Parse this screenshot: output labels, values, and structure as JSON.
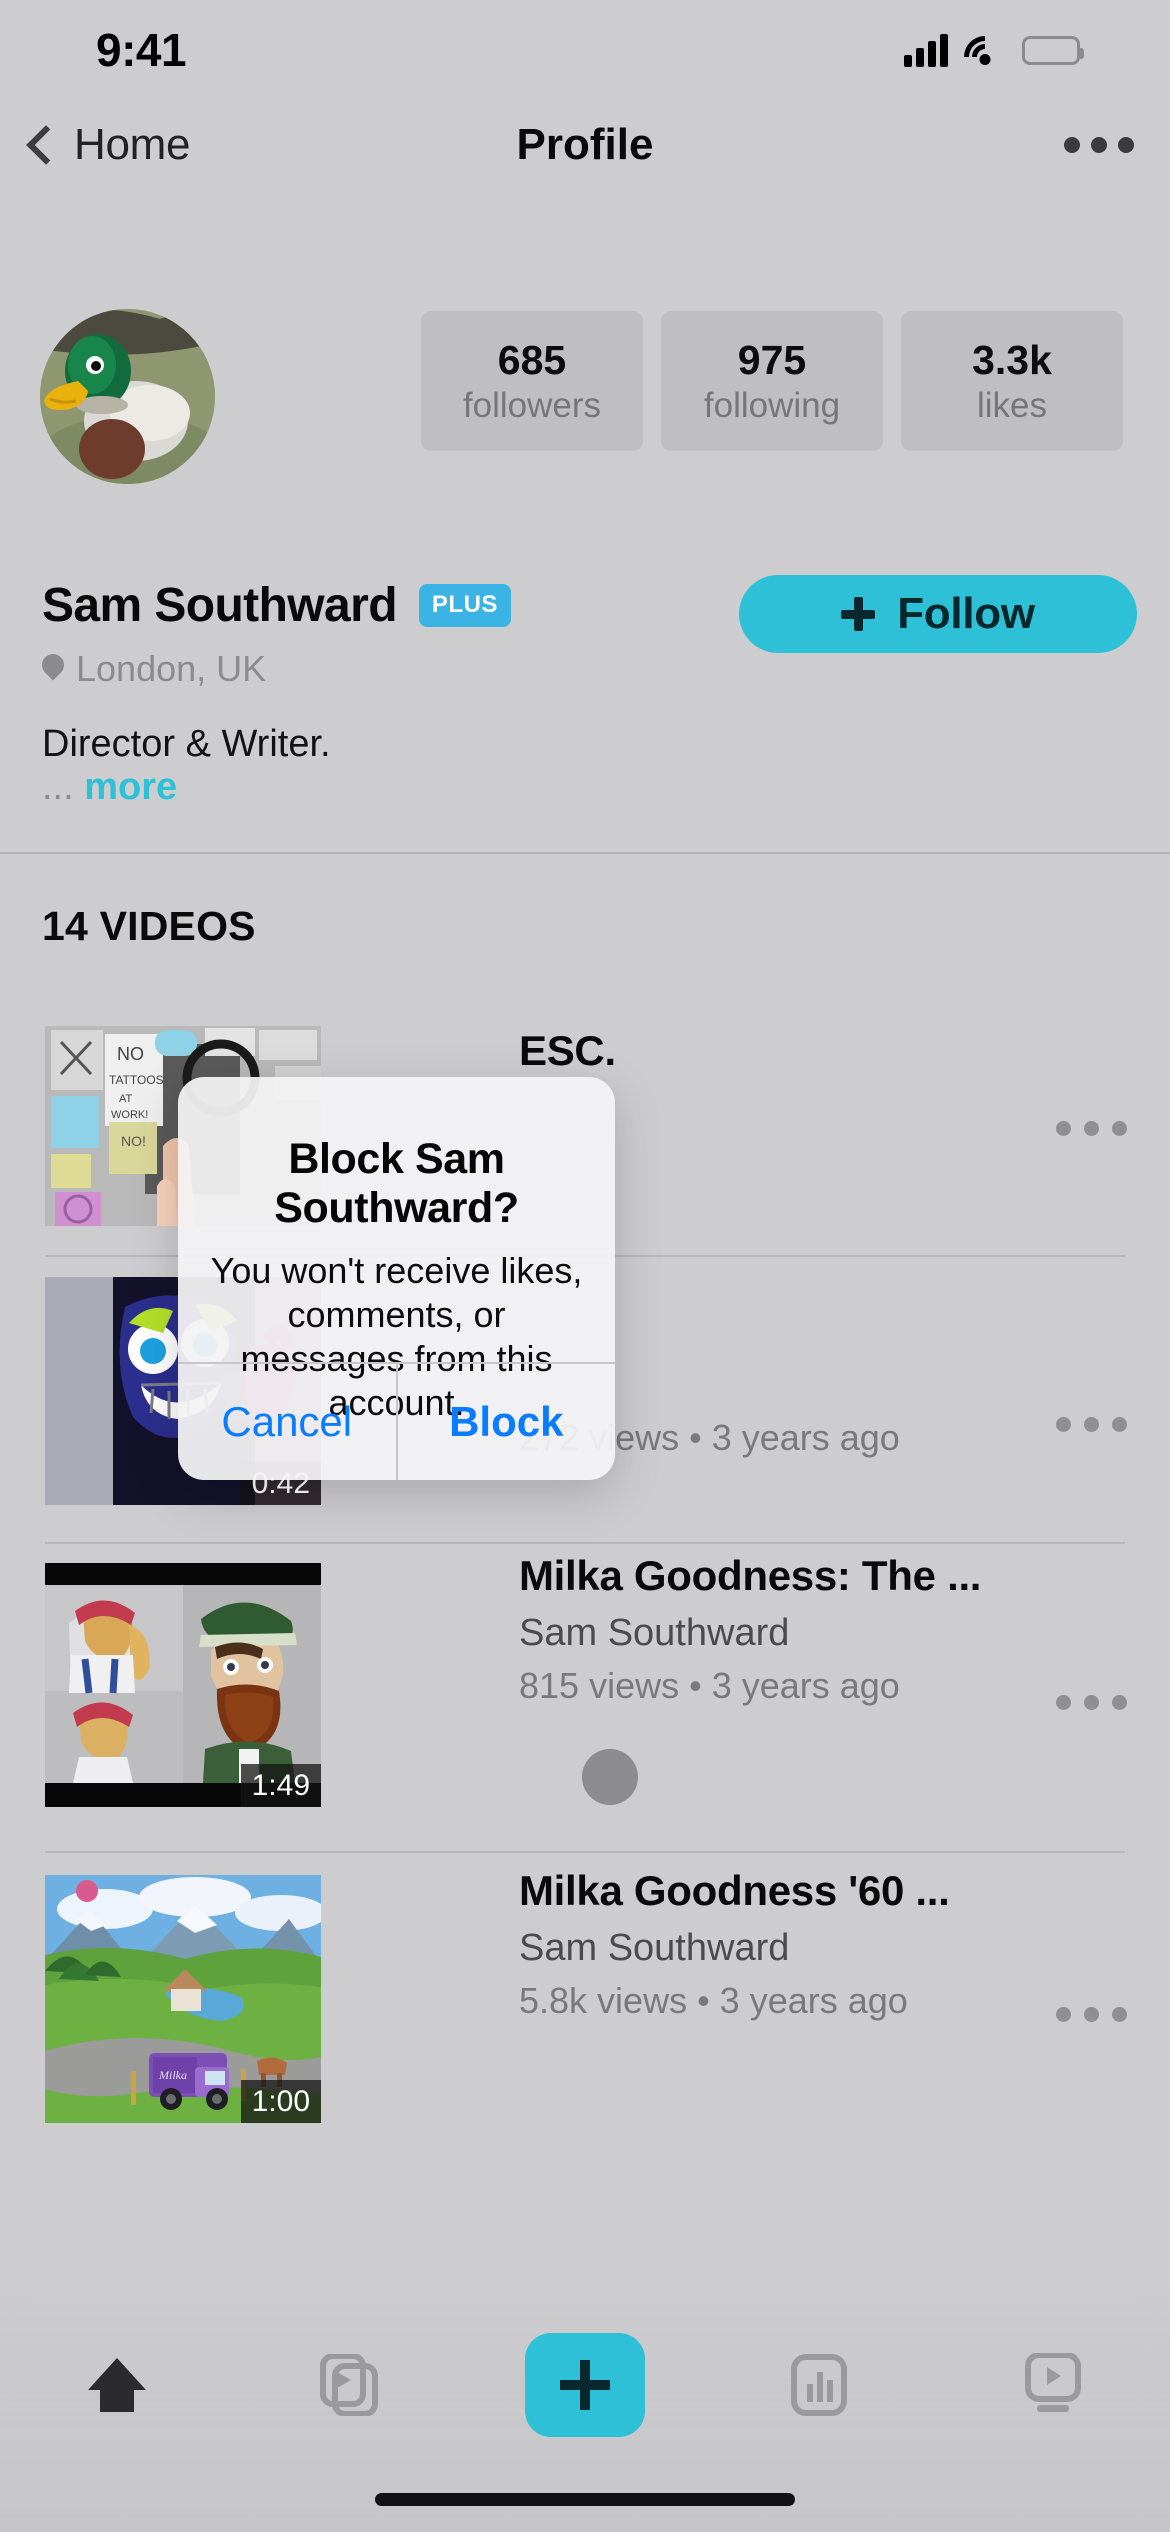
{
  "status_bar": {
    "time": "9:41",
    "cellular_icon": "signal-bars-icon",
    "wifi_icon": "wifi-icon",
    "battery_icon": "battery-icon"
  },
  "nav": {
    "back_label": "Home",
    "back_icon": "chevron-left-icon",
    "title": "Profile",
    "more_icon": "ellipsis-icon"
  },
  "profile": {
    "avatar_alt": "duck-avatar",
    "name": "Sam Southward",
    "badge": "PLUS",
    "location": "London, UK",
    "location_icon": "map-pin-icon",
    "bio": "Director & Writer.",
    "bio_truncation": "...",
    "bio_more_label": "more",
    "follow_label": "Follow",
    "follow_icon": "plus-icon",
    "stats": [
      {
        "value": "685",
        "label": "followers"
      },
      {
        "value": "975",
        "label": "following"
      },
      {
        "value": "3.3k",
        "label": "likes"
      }
    ]
  },
  "videos_section": {
    "header": "14 VIDEOS",
    "items": [
      {
        "title": "ESC.",
        "author": "",
        "meta": "",
        "duration": "",
        "thumb": "sticky-notes-no-tattoos-thumbnail",
        "more_icon": "ellipsis-icon"
      },
      {
        "title": "",
        "author": "",
        "meta": "272 views • 3 years ago",
        "duration": "0:42",
        "thumb": "cartoon-monster-thumbnail",
        "more_icon": "ellipsis-icon"
      },
      {
        "title": "Milka Goodness: The ...",
        "author": "Sam Southward",
        "meta": "815 views • 3 years ago",
        "duration": "1:49",
        "thumb": "claymation-characters-thumbnail",
        "more_icon": "ellipsis-icon"
      },
      {
        "title": "Milka Goodness '60 ...",
        "author": "Sam Southward",
        "meta": "5.8k views • 3 years ago",
        "duration": "1:00",
        "thumb": "purple-truck-alps-thumbnail",
        "more_icon": "ellipsis-icon"
      }
    ]
  },
  "alert": {
    "title": "Block Sam Southward?",
    "message": "You won't receive likes, comments, or messages from this account.",
    "cancel_label": "Cancel",
    "confirm_label": "Block"
  },
  "tab_bar": {
    "items": [
      {
        "icon": "home-icon",
        "active": true
      },
      {
        "icon": "clips-icon",
        "active": false
      },
      {
        "icon": "plus-icon",
        "active": false
      },
      {
        "icon": "analytics-icon",
        "active": false
      },
      {
        "icon": "tv-icon",
        "active": false
      }
    ]
  },
  "colors": {
    "accent": "#2ec0d6",
    "badge": "#3bb4e5",
    "link": "#0a7cff",
    "background": "#cdcdd0"
  }
}
